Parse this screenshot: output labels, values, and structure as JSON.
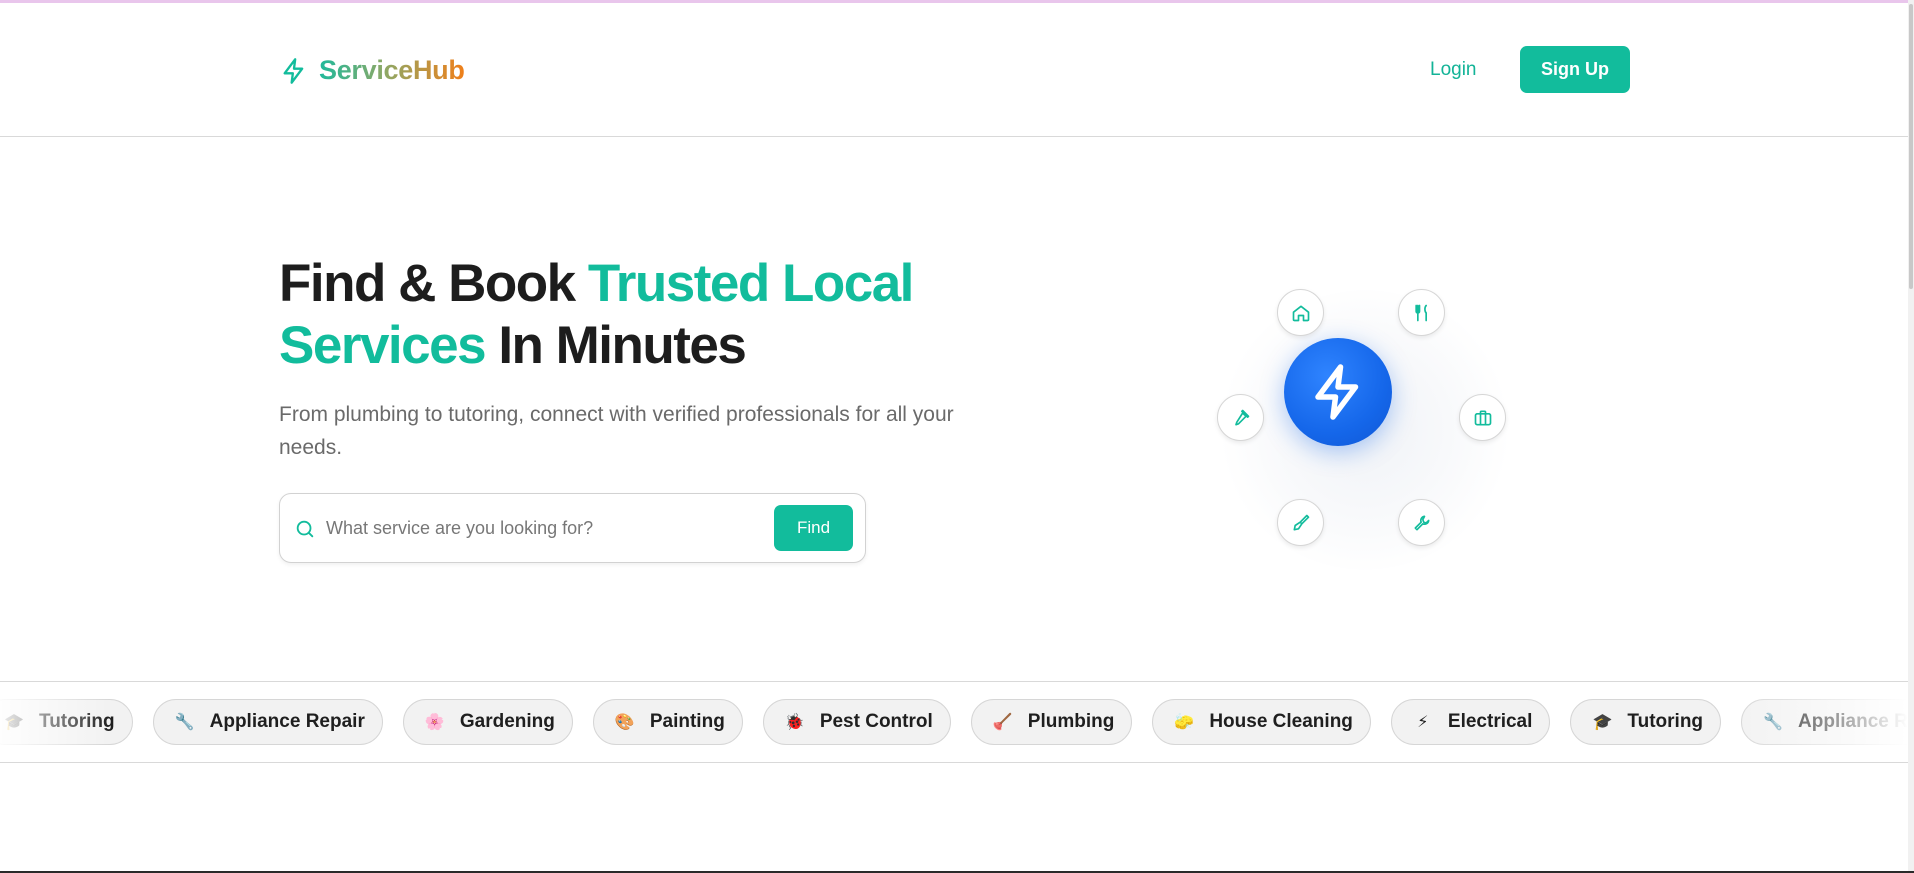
{
  "brand": {
    "name": "ServiceHub",
    "icon": "bolt-icon"
  },
  "header": {
    "login_label": "Login",
    "signup_label": "Sign Up"
  },
  "hero": {
    "title_part1": "Find & Book ",
    "title_accent1": "Trusted Local",
    "title_accent2": "Services",
    "title_part2": " In Minutes",
    "subtitle": "From plumbing to tutoring, connect with verified professionals for all your needs."
  },
  "search": {
    "placeholder": "What service are you looking for?",
    "button_label": "Find",
    "icon": "search-icon"
  },
  "orbit": {
    "center_icon": "bolt-icon",
    "icons": [
      "home-icon",
      "utensils-icon",
      "hammer-icon",
      "briefcase-icon",
      "paintbrush-icon",
      "wrench-icon"
    ]
  },
  "categories": [
    {
      "label": "Tutoring",
      "icon": "graduation-cap-icon"
    },
    {
      "label": "Appliance Repair",
      "icon": "wrench-icon"
    },
    {
      "label": "Gardening",
      "icon": "flower-icon"
    },
    {
      "label": "Painting",
      "icon": "palette-icon"
    },
    {
      "label": "Pest Control",
      "icon": "bug-icon"
    },
    {
      "label": "Plumbing",
      "icon": "plunger-icon"
    },
    {
      "label": "House Cleaning",
      "icon": "sponge-icon"
    },
    {
      "label": "Electrical",
      "icon": "bolt-icon"
    },
    {
      "label": "Tutoring",
      "icon": "graduation-cap-icon"
    },
    {
      "label": "Appliance Repair",
      "icon": "wrench-icon"
    }
  ],
  "colors": {
    "accent": "#12bc9c",
    "primary_blue": "#1567ea",
    "logo_orange": "#f07f1a"
  }
}
